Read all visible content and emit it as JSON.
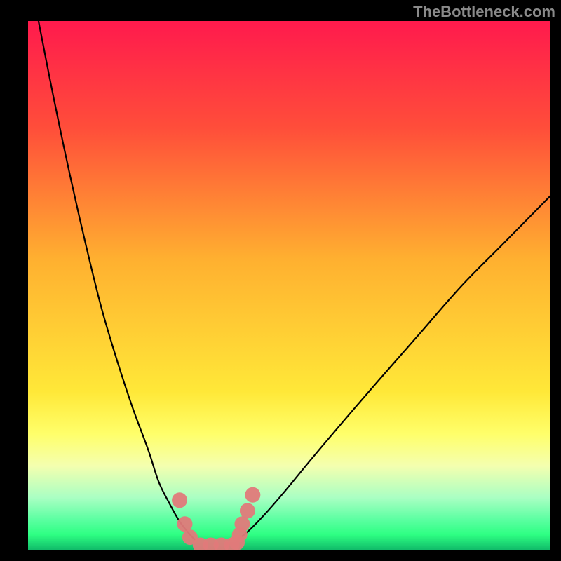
{
  "watermark": "TheBottleneck.com",
  "chart_data": {
    "type": "line",
    "title": "",
    "xlabel": "",
    "ylabel": "",
    "xlim": [
      0,
      100
    ],
    "ylim": [
      0,
      100
    ],
    "grid": false,
    "legend": false,
    "series": [
      {
        "name": "curve-left",
        "x": [
          2,
          5,
          8,
          11,
          14,
          17,
          20,
          23,
          25,
          27,
          29,
          31,
          32
        ],
        "values": [
          100,
          85,
          71,
          58,
          46,
          36,
          27,
          19,
          13,
          9,
          5.5,
          3,
          2
        ]
      },
      {
        "name": "curve-right",
        "x": [
          40,
          42,
          45,
          49,
          54,
          60,
          67,
          75,
          83,
          91,
          100
        ],
        "values": [
          2,
          3.5,
          6.5,
          11,
          17,
          24,
          32,
          41,
          50,
          58,
          67
        ]
      }
    ],
    "markers": {
      "name": "markers",
      "x": [
        29,
        30,
        31,
        33,
        35,
        37,
        39,
        40,
        40.5,
        41,
        42,
        43
      ],
      "values": [
        9.5,
        5,
        2.5,
        1,
        1,
        1,
        1,
        1.5,
        3,
        5,
        7.5,
        10.5
      ],
      "color": "#e07a7a",
      "size": 11
    },
    "gradient_stops": [
      {
        "offset": 0.0,
        "color": "#ff1a4d"
      },
      {
        "offset": 0.2,
        "color": "#ff4d3a"
      },
      {
        "offset": 0.45,
        "color": "#ffb030"
      },
      {
        "offset": 0.7,
        "color": "#ffe838"
      },
      {
        "offset": 0.78,
        "color": "#ffff6a"
      },
      {
        "offset": 0.84,
        "color": "#f4ffaf"
      },
      {
        "offset": 0.9,
        "color": "#aaffc3"
      },
      {
        "offset": 0.94,
        "color": "#5effa3"
      },
      {
        "offset": 0.97,
        "color": "#2eff83"
      },
      {
        "offset": 1.0,
        "color": "#0fb868"
      }
    ]
  }
}
